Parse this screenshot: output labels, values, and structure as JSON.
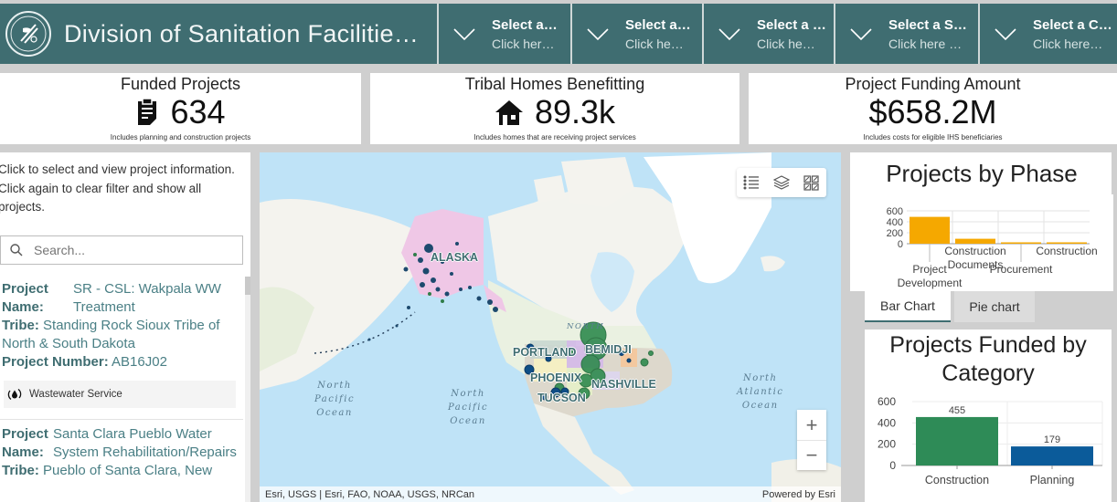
{
  "header": {
    "logo_icon": "ihs-seal-icon",
    "title": "Division of Sanitation Facilitie…",
    "selectors": [
      {
        "label": "Select a…",
        "hint": "Click her…"
      },
      {
        "label": "Select a…",
        "hint": "Click he…"
      },
      {
        "label": "Select a …",
        "hint": "Click he…"
      },
      {
        "label": "Select a S…",
        "hint": "Click here …"
      },
      {
        "label": "Select a C…",
        "hint": "Click here…"
      }
    ]
  },
  "kpis": [
    {
      "title": "Funded Projects",
      "icon": "clipboard-icon",
      "value": "634",
      "note": "Includes planning and construction projects"
    },
    {
      "title": "Tribal Homes Benefitting",
      "icon": "house-icon",
      "value": "89.3k",
      "note": "Includes homes that are receiving project services"
    },
    {
      "title": "Project Funding Amount",
      "icon": "",
      "value": "$658.2M",
      "note": "Includes costs for eligible IHS beneficiaries"
    }
  ],
  "list_panel": {
    "intro": "Click to select and view project information. Click again to clear filter and show all projects.",
    "search_placeholder": "Search...",
    "items": [
      {
        "project_name_label": "Project Name:",
        "project_name": "SR - CSL: Wakpala WW Treatment",
        "tribe_label": "Tribe:",
        "tribe": "Standing Rock Sioux Tribe of North & South Dakota",
        "number_label": "Project Number:",
        "number": "AB16J02",
        "service_icon": "water-drop-cycle-icon",
        "service": "Wastewater Service"
      },
      {
        "project_name_label": "Project Name:",
        "project_name": "Santa Clara Pueblo Water System Rehabilitation/Repairs",
        "tribe_label": "Tribe:",
        "tribe": "Pueblo of Santa Clara, New"
      }
    ]
  },
  "map": {
    "tools": [
      "legend-icon",
      "layers-icon",
      "basemap-gallery-icon"
    ],
    "zoom_in": "+",
    "zoom_out": "−",
    "labels": {
      "alaska": "ALASKA",
      "portland": "PORTLAND",
      "bemidji": "BEMIDJI",
      "phoenix": "PHOENIX",
      "nashville": "NASHVILLE",
      "tucson": "TUCSON",
      "north": "NORTH",
      "ocean1": "North\nPacific\nOcean",
      "ocean2": "North\nPacific\nOcean",
      "ocean3": "North\nAtlantic\nOcean"
    },
    "attribution": "Esri, USGS | Esri, FAO, NOAA, USGS, NRCan",
    "powered_by": "Powered by Esri"
  },
  "tabs": {
    "bar": "Bar Chart",
    "pie": "Pie chart",
    "active": "bar"
  },
  "chart_data": [
    {
      "type": "bar",
      "title": "Projects by Phase",
      "categories": [
        "Project Development",
        "Construction Documents",
        "Procurement",
        "Construction"
      ],
      "values": [
        490,
        90,
        25,
        25
      ],
      "ylim": [
        0,
        600
      ],
      "yticks": [
        0,
        200,
        400,
        600
      ],
      "color": "#f5a800",
      "grid": true
    },
    {
      "type": "bar",
      "title": "Projects Funded by Category",
      "categories": [
        "Construction",
        "Planning"
      ],
      "values": [
        455,
        179
      ],
      "data_labels": [
        "455",
        "179"
      ],
      "colors": [
        "#2e8b57",
        "#0b5b9a"
      ],
      "ylim": [
        0,
        600
      ],
      "yticks": [
        0,
        200,
        400,
        600
      ],
      "grid": true
    }
  ]
}
